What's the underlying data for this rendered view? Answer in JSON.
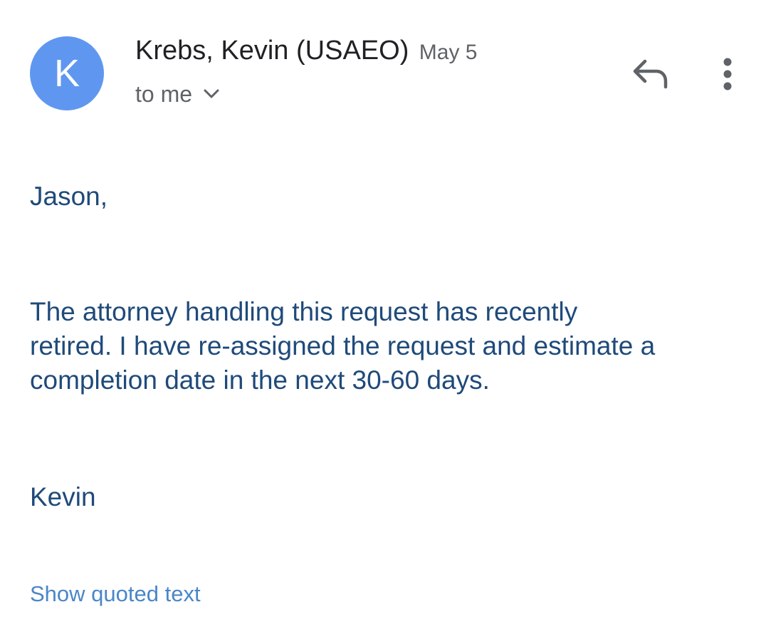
{
  "header": {
    "avatar_letter": "K",
    "sender_name": "Krebs, Kevin (USAEO)",
    "date": "May 5",
    "recipient": "to me"
  },
  "icons": {
    "reply": "reply-icon",
    "more": "more-vert-icon",
    "expand": "chevron-down-icon"
  },
  "colors": {
    "avatar": "#5f97f0",
    "body_text": "#1f4a7a",
    "link": "#4a86c8",
    "secondary_text": "#5f6368"
  },
  "message": {
    "greeting": "Jason,",
    "paragraph_lines": [
      "The attorney handling this request has recently",
      "retired.  I have re-assigned the request and estimate a",
      "completion date in the next 30-60 days."
    ],
    "signoff": "Kevin"
  },
  "footer": {
    "show_quoted_label": "Show quoted text"
  }
}
